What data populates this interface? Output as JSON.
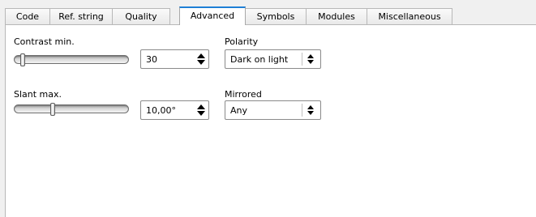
{
  "tabs": [
    {
      "label": "Code"
    },
    {
      "label": "Ref. string"
    },
    {
      "label": "Quality"
    },
    {
      "label": "Advanced",
      "active": true
    },
    {
      "label": "Symbols"
    },
    {
      "label": "Modules"
    },
    {
      "label": "Miscellaneous"
    }
  ],
  "contrast": {
    "label": "Contrast min.",
    "value": "30",
    "slider_fraction": 0.06
  },
  "polarity": {
    "label": "Polarity",
    "value": "Dark on light"
  },
  "slant": {
    "label": "Slant max.",
    "value": "10,00°",
    "slider_fraction": 0.33
  },
  "mirrored": {
    "label": "Mirrored",
    "value": "Any"
  },
  "colors": {
    "active_tab_accent": "#1e7fd6",
    "panel_background": "#ffffff",
    "window_background": "#f0f0f0"
  }
}
